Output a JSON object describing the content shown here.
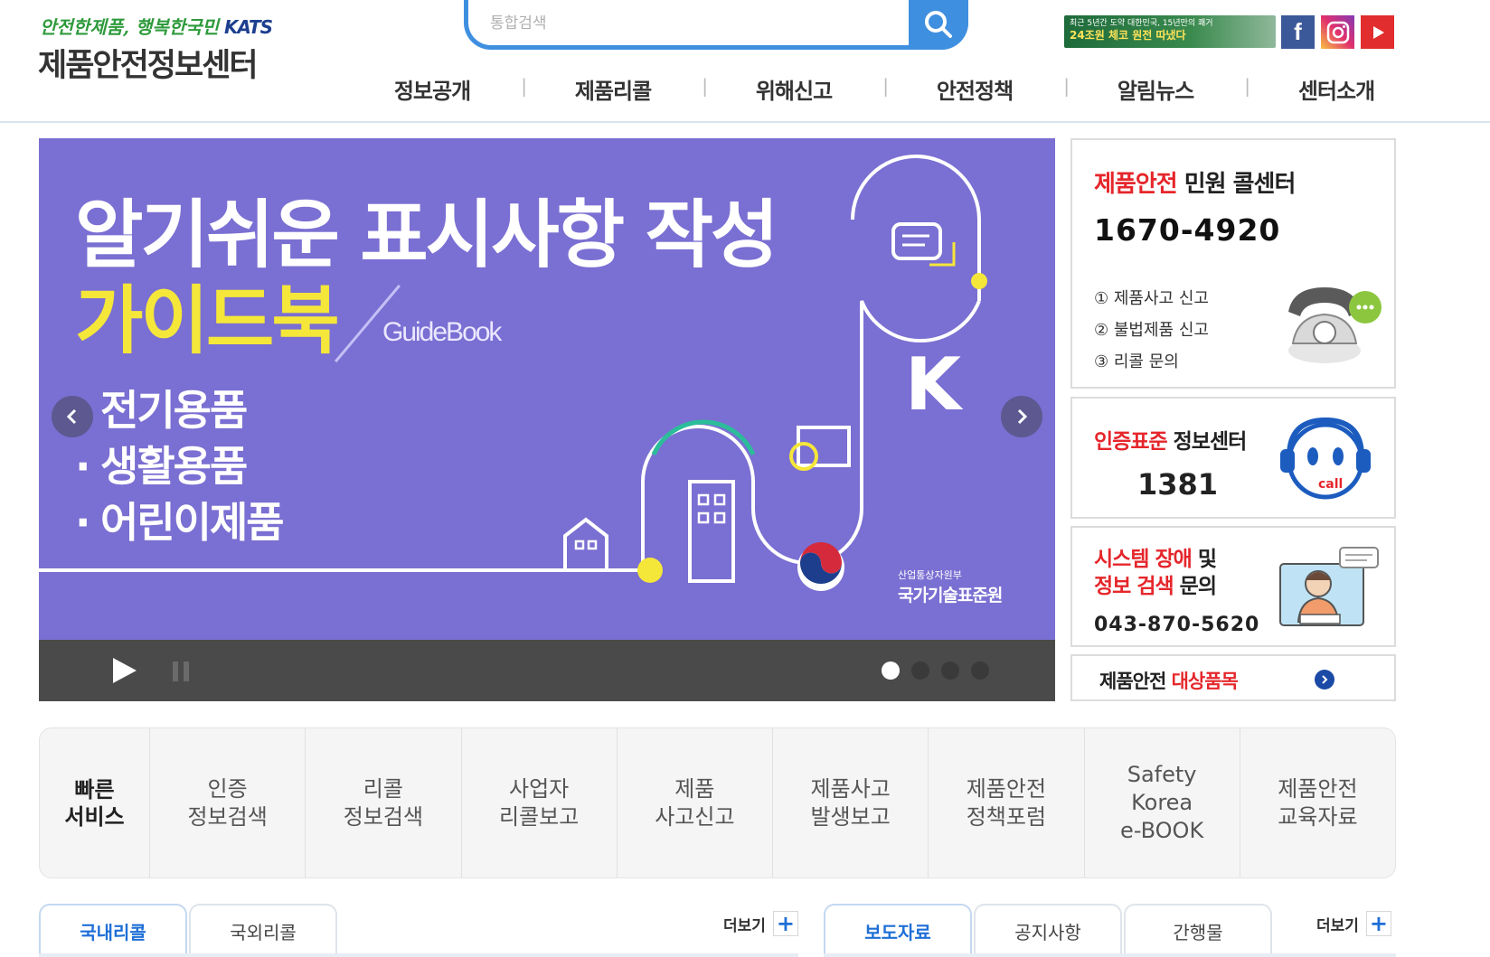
{
  "header": {
    "tagline": "안전한제품, 행복한국민",
    "tagline_brand": "KATS",
    "site_title": "제품안전정보센터",
    "search_placeholder": "통합검색",
    "top_banner_line1": "최근 5년간 도약 대한민국, 15년만의 쾌거",
    "top_banner_line2": "24조원 체코 원전 따냈다",
    "sns": [
      "facebook-icon",
      "instagram-icon",
      "youtube-icon"
    ]
  },
  "gnb": [
    "정보공개",
    "제품리콜",
    "위해신고",
    "안전정책",
    "알림뉴스",
    "센터소개"
  ],
  "hero": {
    "title": "알기쉬운 표시사항 작성",
    "subtitle": "가이드북",
    "guidebook": "GuideBook",
    "categories": [
      "전기용품",
      "생활용품",
      "어린이제품"
    ],
    "ministry_small": "산업통상자원부",
    "ministry": "국가기술표준원",
    "slide_count": 4,
    "active_slide": 1
  },
  "callcenter": {
    "title_red": "제품안전",
    "title_rest": " 민원 콜센터",
    "phone": "1670-4920",
    "items": [
      "① 제품사고 신고",
      "② 불법제품 신고",
      "③ 리콜 문의"
    ]
  },
  "certcenter": {
    "title_red": "인증표준",
    "title_rest": " 정보센터",
    "phone": "1381"
  },
  "syscenter": {
    "title_red1": "시스템 장애",
    "title_rest1": " 및",
    "title_red2": "정보 검색",
    "title_rest2": " 문의",
    "phone": "043-870-5620"
  },
  "target_items": {
    "label_black": "제품안전 ",
    "label_red": "대상품목"
  },
  "quick": {
    "head": "빠른\n서비스",
    "items": [
      "인증\n정보검색",
      "리콜\n정보검색",
      "사업자\n리콜보고",
      "제품\n사고신고",
      "제품사고\n발생보고",
      "제품안전\n정책포럼",
      "Safety\nKorea\ne-BOOK",
      "제품안전\n교육자료"
    ]
  },
  "tabs_left": [
    "국내리콜",
    "국외리콜"
  ],
  "tabs_right": [
    "보도자료",
    "공지사항",
    "간행물"
  ],
  "more_label": "더보기",
  "colors": {
    "brand_blue": "#3f8fe0",
    "hero_bg": "#7a6fd2",
    "accent_red": "#e5262b",
    "hero_yellow": "#f5e63a"
  }
}
